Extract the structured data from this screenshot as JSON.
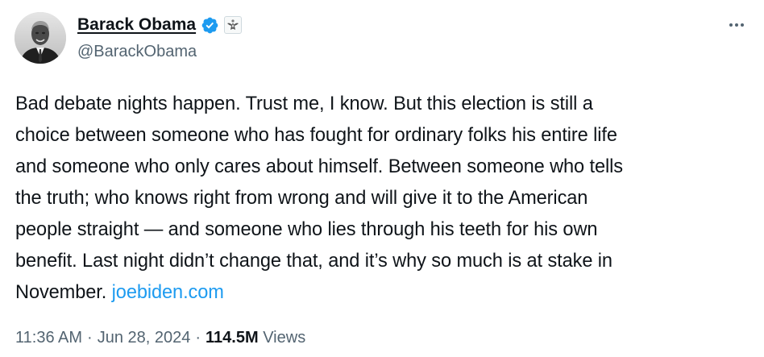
{
  "author": {
    "display_name": "Barack Obama",
    "handle": "@BarackObama",
    "verified_badge_icon": "verified-badge-icon",
    "affiliation_icon": "us-seal-icon",
    "verified_color": "#1d9bf0"
  },
  "tweet": {
    "text": "Bad debate nights happen. Trust me, I know. But this election is still a\nchoice between someone who has fought for ordinary folks his entire life\nand someone who only cares about himself. Between someone who tells\nthe truth; who knows right from wrong and will give it to the American\npeople straight — and someone who lies through his teeth for his own\nbenefit. Last night didn’t change that, and it’s why so much is at stake in\nNovember.",
    "link_text": "joebiden.com",
    "link_color": "#1d9bf0"
  },
  "meta": {
    "time": "11:36 AM",
    "separator": "·",
    "date": "Jun 28, 2024",
    "views_count": "114.5M",
    "views_label": "Views"
  },
  "actions": {
    "more_icon": "more-horizontal-icon"
  }
}
